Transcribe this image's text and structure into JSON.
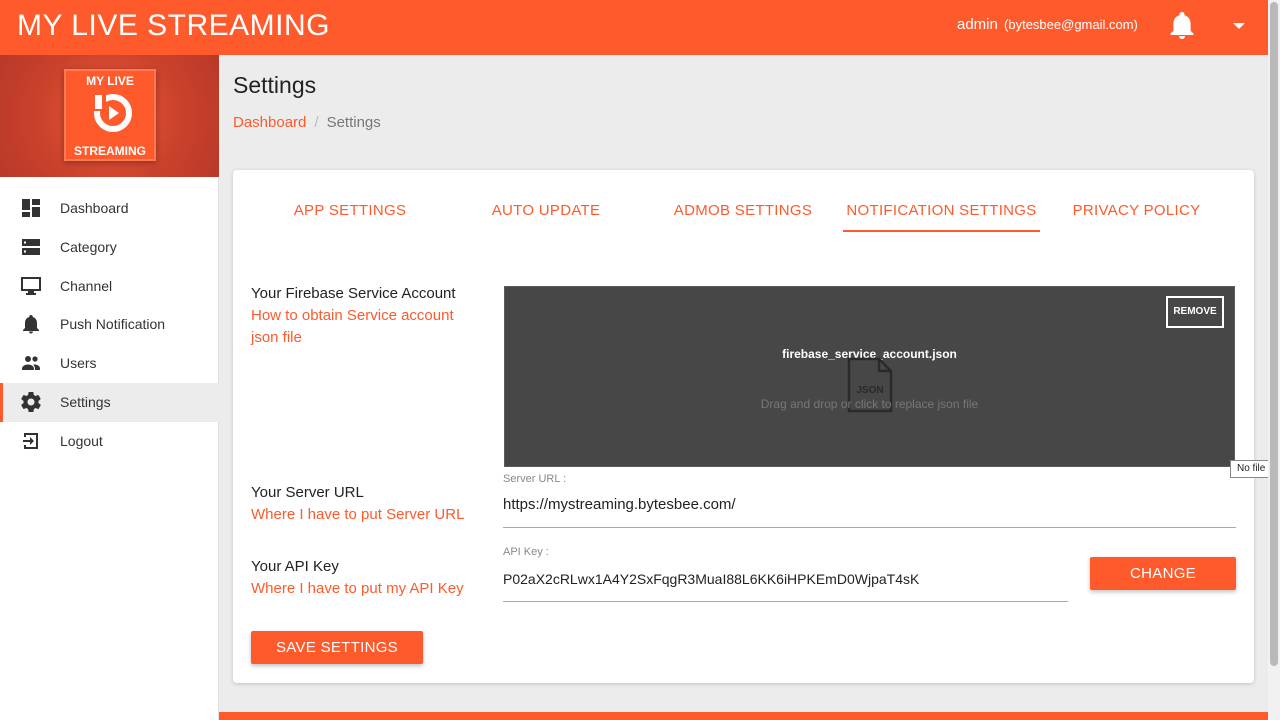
{
  "header": {
    "brand": "MY LIVE STREAMING",
    "user_name": "admin",
    "user_email": "(bytesbee@gmail.com)",
    "icons": [
      "bell-icon",
      "chevron-down-icon"
    ]
  },
  "sidebar": {
    "logo_top": "MY LIVE",
    "logo_bottom": "STREAMING",
    "items": [
      {
        "label": "Dashboard",
        "icon": "dashboard-icon"
      },
      {
        "label": "Category",
        "icon": "category-icon"
      },
      {
        "label": "Channel",
        "icon": "monitor-icon"
      },
      {
        "label": "Push Notification",
        "icon": "bell-icon"
      },
      {
        "label": "Users",
        "icon": "users-icon"
      },
      {
        "label": "Settings",
        "icon": "gear-icon",
        "active": true
      },
      {
        "label": "Logout",
        "icon": "logout-icon"
      }
    ]
  },
  "page": {
    "title": "Settings",
    "breadcrumb": {
      "home": "Dashboard",
      "separator": "/",
      "current": "Settings"
    }
  },
  "tabs": [
    {
      "label": "APP SETTINGS"
    },
    {
      "label": "AUTO UPDATE"
    },
    {
      "label": "ADMOB SETTINGS"
    },
    {
      "label": "NOTIFICATION SETTINGS",
      "active": true
    },
    {
      "label": "PRIVACY POLICY"
    }
  ],
  "firebase": {
    "label": "Your Firebase Service Account",
    "help_line1": "How to obtain Service account",
    "help_line2": "json file",
    "remove_label": "REMOVE",
    "file_name": "firebase_service_account.json",
    "file_icon_text": "JSON",
    "drop_message": "Drag and drop or click to replace json file",
    "tooltip": "No file chosen"
  },
  "server": {
    "label": "Your Server URL",
    "help": "Where I have to put Server URL",
    "field_label": "Server URL :",
    "value": "https://mystreaming.bytesbee.com/"
  },
  "api": {
    "label": "Your API Key",
    "help": "Where I have to put my API Key",
    "field_label": "API Key :",
    "value": "P02aX2cRLwx1A4Y2SxFqgR3MuaI88L6KK6iHPKEmD0WjpaT4sK",
    "change_label": "CHANGE"
  },
  "actions": {
    "save_label": "SAVE SETTINGS"
  },
  "colors": {
    "accent": "#ff5a2c",
    "dropzone": "#474747",
    "sidebar_active": "#ececec"
  }
}
